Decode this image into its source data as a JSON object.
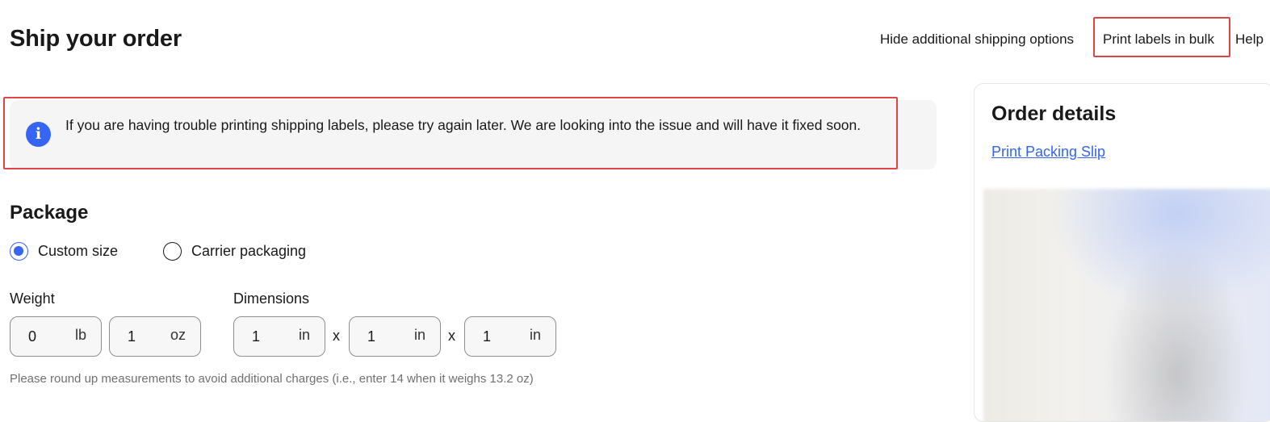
{
  "header": {
    "title": "Ship your order",
    "links": {
      "hide_options": "Hide additional shipping options",
      "print_bulk": "Print labels in bulk",
      "help": "Help"
    }
  },
  "notice": {
    "icon": "info-icon",
    "icon_glyph": "i",
    "text": "If you are having trouble printing shipping labels, please try again later. We are looking into the issue and will have it fixed soon."
  },
  "package": {
    "title": "Package",
    "options": [
      {
        "label": "Custom size",
        "selected": true
      },
      {
        "label": "Carrier packaging",
        "selected": false
      }
    ],
    "weight": {
      "label": "Weight",
      "lb_value": "0",
      "lb_unit": "lb",
      "oz_value": "1",
      "oz_unit": "oz"
    },
    "dimensions": {
      "label": "Dimensions",
      "separator": "x",
      "length": {
        "value": "1",
        "unit": "in"
      },
      "width": {
        "value": "1",
        "unit": "in"
      },
      "height": {
        "value": "1",
        "unit": "in"
      }
    },
    "hint": "Please round up measurements to avoid additional charges (i.e., enter 14 when it weighs 13.2 oz)"
  },
  "order_details": {
    "title": "Order details",
    "packing_slip_link": "Print Packing Slip"
  },
  "colors": {
    "accent": "#3665f3",
    "highlight_border": "#e04545",
    "notice_bg": "#f5f5f5"
  }
}
